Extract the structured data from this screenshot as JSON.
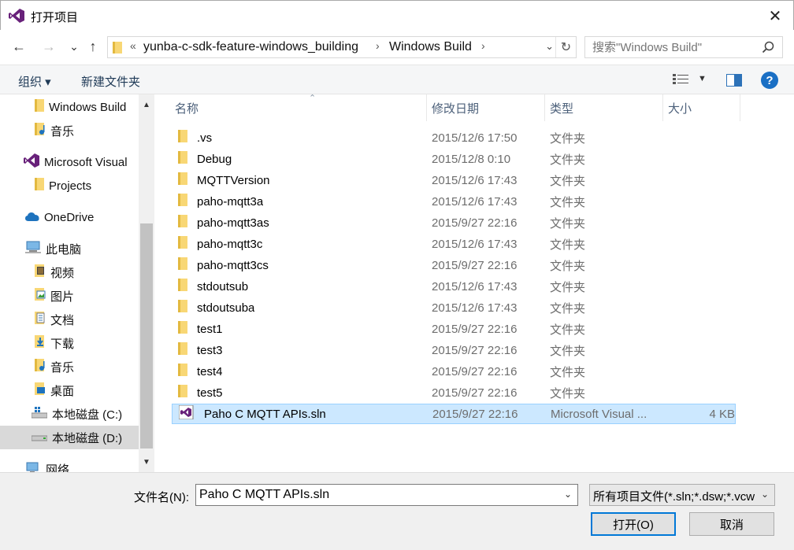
{
  "window": {
    "title": "打开项目",
    "close_glyph": "✕"
  },
  "address": {
    "back_glyph": "←",
    "forward_glyph": "→",
    "recent_glyph": "⌄",
    "up_glyph": "↑",
    "overflow": "«",
    "crumbs": [
      "yunba-c-sdk-feature-windows_building",
      "Windows Build"
    ],
    "separator": "›",
    "dropdown_glyph": "⌄",
    "refresh_glyph": "↻"
  },
  "search": {
    "placeholder": "搜索\"Windows Build\""
  },
  "toolbar": {
    "organize": "组织 ▾",
    "new_folder": "新建文件夹",
    "help": "?"
  },
  "sidebar": {
    "items": [
      {
        "label": "Windows Build",
        "icon": "folder-icon"
      },
      {
        "label": "音乐",
        "icon": "music-folder-icon"
      },
      {
        "label": "Microsoft Visual",
        "icon": "visual-studio-icon"
      },
      {
        "label": "Projects",
        "icon": "folder-icon"
      },
      {
        "label": "OneDrive",
        "icon": "onedrive-icon"
      },
      {
        "label": "此电脑",
        "icon": "computer-icon"
      },
      {
        "label": "视频",
        "icon": "videos-folder-icon"
      },
      {
        "label": "图片",
        "icon": "pictures-folder-icon"
      },
      {
        "label": "文档",
        "icon": "documents-folder-icon"
      },
      {
        "label": "下载",
        "icon": "downloads-folder-icon"
      },
      {
        "label": "音乐",
        "icon": "music-folder-icon"
      },
      {
        "label": "桌面",
        "icon": "desktop-folder-icon"
      },
      {
        "label": "本地磁盘 (C:)",
        "icon": "windows-drive-icon"
      },
      {
        "label": "本地磁盘 (D:)",
        "icon": "drive-icon"
      },
      {
        "label": "网络",
        "icon": "network-icon"
      }
    ],
    "scroll_up": "▲",
    "scroll_down": "▼"
  },
  "columns": {
    "name": "名称",
    "date": "修改日期",
    "type": "类型",
    "size": "大小",
    "sort_glyph": "⌃"
  },
  "files": [
    {
      "name": ".vs",
      "date": "2015/12/6 17:50",
      "type": "文件夹",
      "size": "",
      "icon": "folder-icon"
    },
    {
      "name": "Debug",
      "date": "2015/12/8 0:10",
      "type": "文件夹",
      "size": "",
      "icon": "folder-icon"
    },
    {
      "name": "MQTTVersion",
      "date": "2015/12/6 17:43",
      "type": "文件夹",
      "size": "",
      "icon": "folder-icon"
    },
    {
      "name": "paho-mqtt3a",
      "date": "2015/12/6 17:43",
      "type": "文件夹",
      "size": "",
      "icon": "folder-icon"
    },
    {
      "name": "paho-mqtt3as",
      "date": "2015/9/27 22:16",
      "type": "文件夹",
      "size": "",
      "icon": "folder-icon"
    },
    {
      "name": "paho-mqtt3c",
      "date": "2015/12/6 17:43",
      "type": "文件夹",
      "size": "",
      "icon": "folder-icon"
    },
    {
      "name": "paho-mqtt3cs",
      "date": "2015/9/27 22:16",
      "type": "文件夹",
      "size": "",
      "icon": "folder-icon"
    },
    {
      "name": "stdoutsub",
      "date": "2015/12/6 17:43",
      "type": "文件夹",
      "size": "",
      "icon": "folder-icon"
    },
    {
      "name": "stdoutsuba",
      "date": "2015/12/6 17:43",
      "type": "文件夹",
      "size": "",
      "icon": "folder-icon"
    },
    {
      "name": "test1",
      "date": "2015/9/27 22:16",
      "type": "文件夹",
      "size": "",
      "icon": "folder-icon"
    },
    {
      "name": "test3",
      "date": "2015/9/27 22:16",
      "type": "文件夹",
      "size": "",
      "icon": "folder-icon"
    },
    {
      "name": "test4",
      "date": "2015/9/27 22:16",
      "type": "文件夹",
      "size": "",
      "icon": "folder-icon"
    },
    {
      "name": "test5",
      "date": "2015/9/27 22:16",
      "type": "文件夹",
      "size": "",
      "icon": "folder-icon"
    },
    {
      "name": "Paho C MQTT APIs.sln",
      "date": "2015/9/27 22:16",
      "type": "Microsoft Visual ...",
      "size": "4 KB",
      "icon": "solution-file-icon",
      "selected": true
    }
  ],
  "footer": {
    "filename_label": "文件名(N):",
    "filename_value": "Paho C MQTT APIs.sln",
    "dropdown_glyph": "⌄",
    "filter_value": "所有项目文件(*.sln;*.dsw;*.vcw",
    "open_button": "打开(O)",
    "cancel_button": "取消"
  },
  "colors": {
    "selection_bg": "#cce8ff",
    "selection_border": "#99d1ff",
    "folder": "#f8d775",
    "accent": "#0078d7",
    "vs_purple": "#68217a"
  }
}
